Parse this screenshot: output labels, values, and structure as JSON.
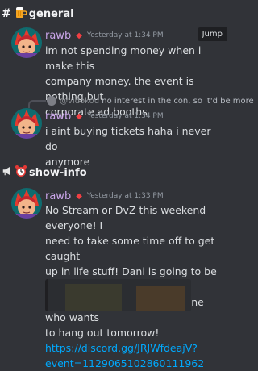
{
  "channels": {
    "general": {
      "hash": "#",
      "name": "general",
      "emoji": "beer-mug-emoji"
    },
    "show_info": {
      "emoji1": "megaphone-emoji",
      "emoji2": "alarm-clock-emoji",
      "name": "show-info"
    }
  },
  "messages": [
    {
      "author": "rawb",
      "time": "Yesterday at 1:34 PM",
      "lines": [
        "im not spending money when i make this",
        "company money. the event is nothing but",
        "corporate ad booths"
      ]
    },
    {
      "reply": {
        "mention": "@vidokou",
        "text": "no interest in the con, so it'd be more"
      },
      "author": "rawb",
      "time": "Yesterday at 1:34 PM",
      "lines": [
        "i aint buying tickets haha i never do",
        "anymore"
      ]
    },
    {
      "author": "rawb",
      "time": "Yesterday at 1:33 PM",
      "lines": [
        "No Stream or DvZ this weekend everyone! I",
        "need to take some time off to get caught",
        "up in life stuff! Dani is going to be hosting a",
        "Minecraft pvp event for anyone who wants",
        "to hang out tomorrow!"
      ],
      "link_lines": [
        "https://discord.gg/JRJWfdeajV?",
        "event=1129065102860111962"
      ]
    }
  ],
  "tooltip": {
    "jump": "Jump"
  },
  "colors": {
    "background": "#313338",
    "author": "#c9a5e8",
    "link": "#00a8fc",
    "timestamp": "#949ba4",
    "tag": "#f23f43"
  }
}
